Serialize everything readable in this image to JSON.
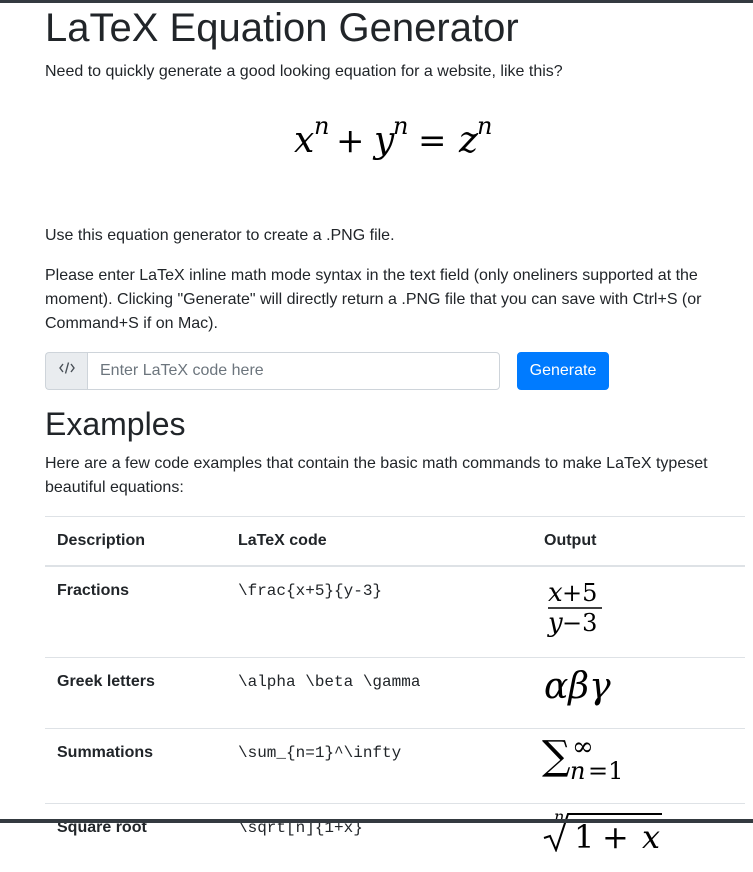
{
  "page": {
    "title": "LaTeX Equation Generator",
    "intro": "Need to quickly generate a good looking equation for a website, like this?",
    "use_text": "Use this equation generator to create a .PNG file.",
    "enter_text": "Please enter LaTeX inline math mode syntax in the text field (only oneliners supported at the moment). Clicking \"Generate\" will directly return a .PNG file that you can save with Ctrl+S (or Command+S if on Mac)."
  },
  "form": {
    "prepend_icon": "code-icon",
    "input_placeholder": "Enter LaTeX code here",
    "input_value": "",
    "generate_label": "Generate"
  },
  "examples": {
    "heading": "Examples",
    "description": "Here are a few code examples that contain the basic math commands to make LaTeX typeset beautiful equations:",
    "columns": [
      "Description",
      "LaTeX code",
      "Output"
    ],
    "rows": [
      {
        "description": "Fractions",
        "code": "\\frac{x+5}{y-3}"
      },
      {
        "description": "Greek letters",
        "code": "\\alpha \\beta \\gamma"
      },
      {
        "description": "Summations",
        "code": "\\sum_{n=1}^\\infty"
      },
      {
        "description": "Square root",
        "code": "\\sqrt[n]{1+x}"
      }
    ]
  },
  "colors": {
    "primary": "#007bff",
    "text": "#212529",
    "border": "#dee2e6",
    "topbar": "#343a40"
  }
}
